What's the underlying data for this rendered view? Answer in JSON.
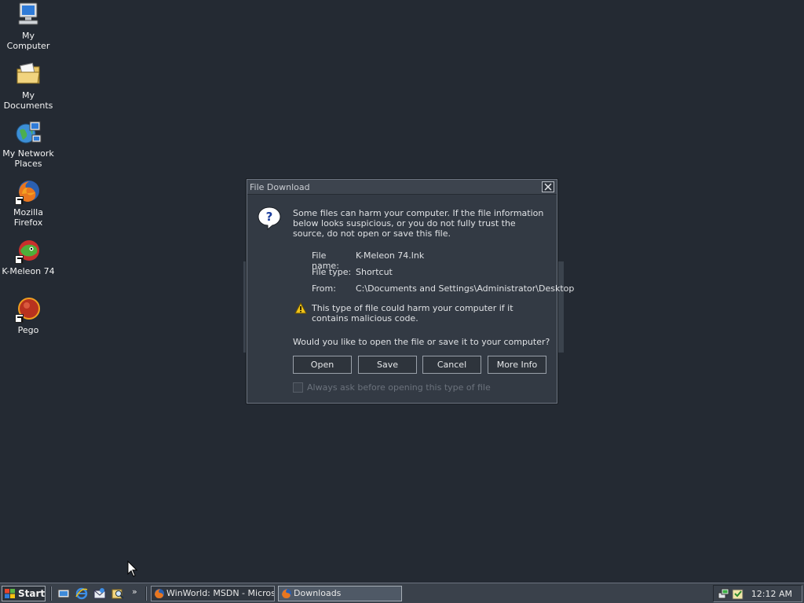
{
  "desktop": {
    "icons": [
      {
        "label": "My Computer"
      },
      {
        "label": "My Documents"
      },
      {
        "label": "My Network Places"
      },
      {
        "label": "Mozilla Firefox"
      },
      {
        "label": "K-Meleon 74"
      },
      {
        "label": "Pego"
      }
    ]
  },
  "dialog": {
    "title": "File Download",
    "intro": "Some files can harm your computer. If the file information below looks suspicious, or you do not fully trust the source, do not open or save this file.",
    "file_name_label": "File name:",
    "file_name": "K-Meleon 74.lnk",
    "file_type_label": "File type:",
    "file_type": "Shortcut",
    "from_label": "From:",
    "from": "C:\\Documents and Settings\\Administrator\\Desktop",
    "caution": "This type of file could harm your computer if it contains malicious code.",
    "question": "Would you like to open the file or save it to your computer?",
    "buttons": {
      "open": "Open",
      "save": "Save",
      "cancel": "Cancel",
      "more_info": "More Info"
    },
    "always_ask_label": "Always ask before opening this type of file",
    "always_ask_checked": false
  },
  "taskbar": {
    "start_label": "Start",
    "chevron": "»",
    "tasks": [
      {
        "label": "WinWorld: MSDN - Micros...",
        "active": false
      },
      {
        "label": "Downloads",
        "active": true
      }
    ],
    "clock": "12:12 AM"
  },
  "colors": {
    "desktop": "#242a33",
    "dialog_bg": "#333a44",
    "taskbar": "#3a414b",
    "accent_warning": "#f0c419"
  }
}
